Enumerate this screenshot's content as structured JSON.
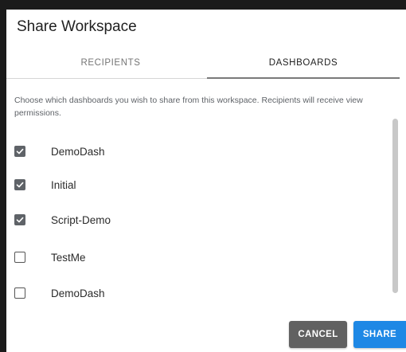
{
  "dialog": {
    "title": "Share Workspace"
  },
  "tabs": [
    {
      "label": "RECIPIENTS",
      "active": false
    },
    {
      "label": "DASHBOARDS",
      "active": true
    }
  ],
  "instructions": "Choose which dashboards you wish to share from this workspace. Recipients will receive view permissions.",
  "dashboards": [
    {
      "name": "DemoDash",
      "checked": true
    },
    {
      "name": "Initial",
      "checked": true
    },
    {
      "name": "Script-Demo",
      "checked": true
    },
    {
      "name": "TestMe",
      "checked": false
    },
    {
      "name": "DemoDash",
      "checked": false
    }
  ],
  "actions": {
    "cancel_label": "CANCEL",
    "share_label": "SHARE"
  },
  "colors": {
    "share_button": "#1e88e5",
    "cancel_button": "#616161",
    "checkbox_checked": "#5f6368"
  },
  "icons": {
    "checked": "checkbox-checked-icon",
    "unchecked": "checkbox-unchecked-icon"
  }
}
